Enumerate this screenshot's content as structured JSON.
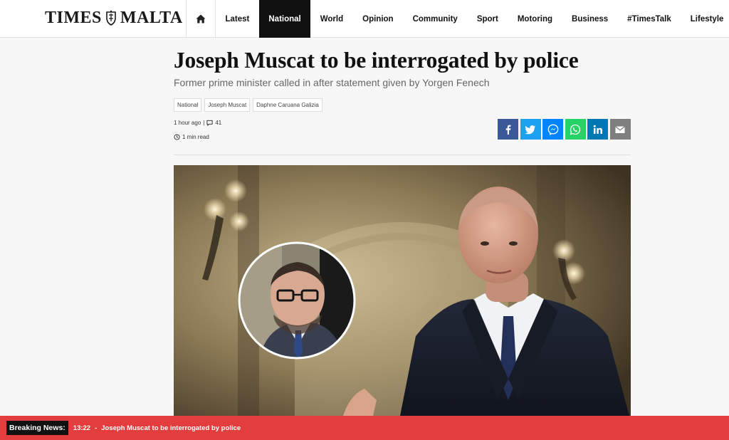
{
  "header": {
    "logo_left": "TIMES",
    "logo_right": "MALTA",
    "nav": [
      {
        "label": "Latest",
        "active": false
      },
      {
        "label": "National",
        "active": true
      },
      {
        "label": "World",
        "active": false
      },
      {
        "label": "Opinion",
        "active": false
      },
      {
        "label": "Community",
        "active": false
      },
      {
        "label": "Sport",
        "active": false
      },
      {
        "label": "Motoring",
        "active": false
      },
      {
        "label": "Business",
        "active": false
      },
      {
        "label": "#TimesTalk",
        "active": false
      },
      {
        "label": "Lifestyle",
        "active": false
      }
    ]
  },
  "article": {
    "title": "Joseph Muscat to be interrogated by police",
    "subtitle": "Former prime minister called in after statement given by Yorgen Fenech",
    "tags": [
      "National",
      "Joseph Muscat",
      "Daphne Caruana Galizia"
    ],
    "time_ago": "1 hour ago",
    "meta_sep": "|",
    "comments": "41",
    "read_time": "1 min read"
  },
  "share": [
    {
      "name": "facebook-icon",
      "color": "#3b5998"
    },
    {
      "name": "twitter-icon",
      "color": "#1da1f2"
    },
    {
      "name": "messenger-icon",
      "color": "#0084ff"
    },
    {
      "name": "whatsapp-icon",
      "color": "#25d366"
    },
    {
      "name": "linkedin-icon",
      "color": "#0077b5"
    },
    {
      "name": "email-icon",
      "color": "#7f7f7f"
    }
  ],
  "breaking": {
    "label": "Breaking News:",
    "time": "13:22",
    "sep": "-",
    "headline": "Joseph Muscat to be interrogated by police"
  },
  "colors": {
    "breaking_bar": "#e33d3d",
    "nav_active": "#111111"
  }
}
